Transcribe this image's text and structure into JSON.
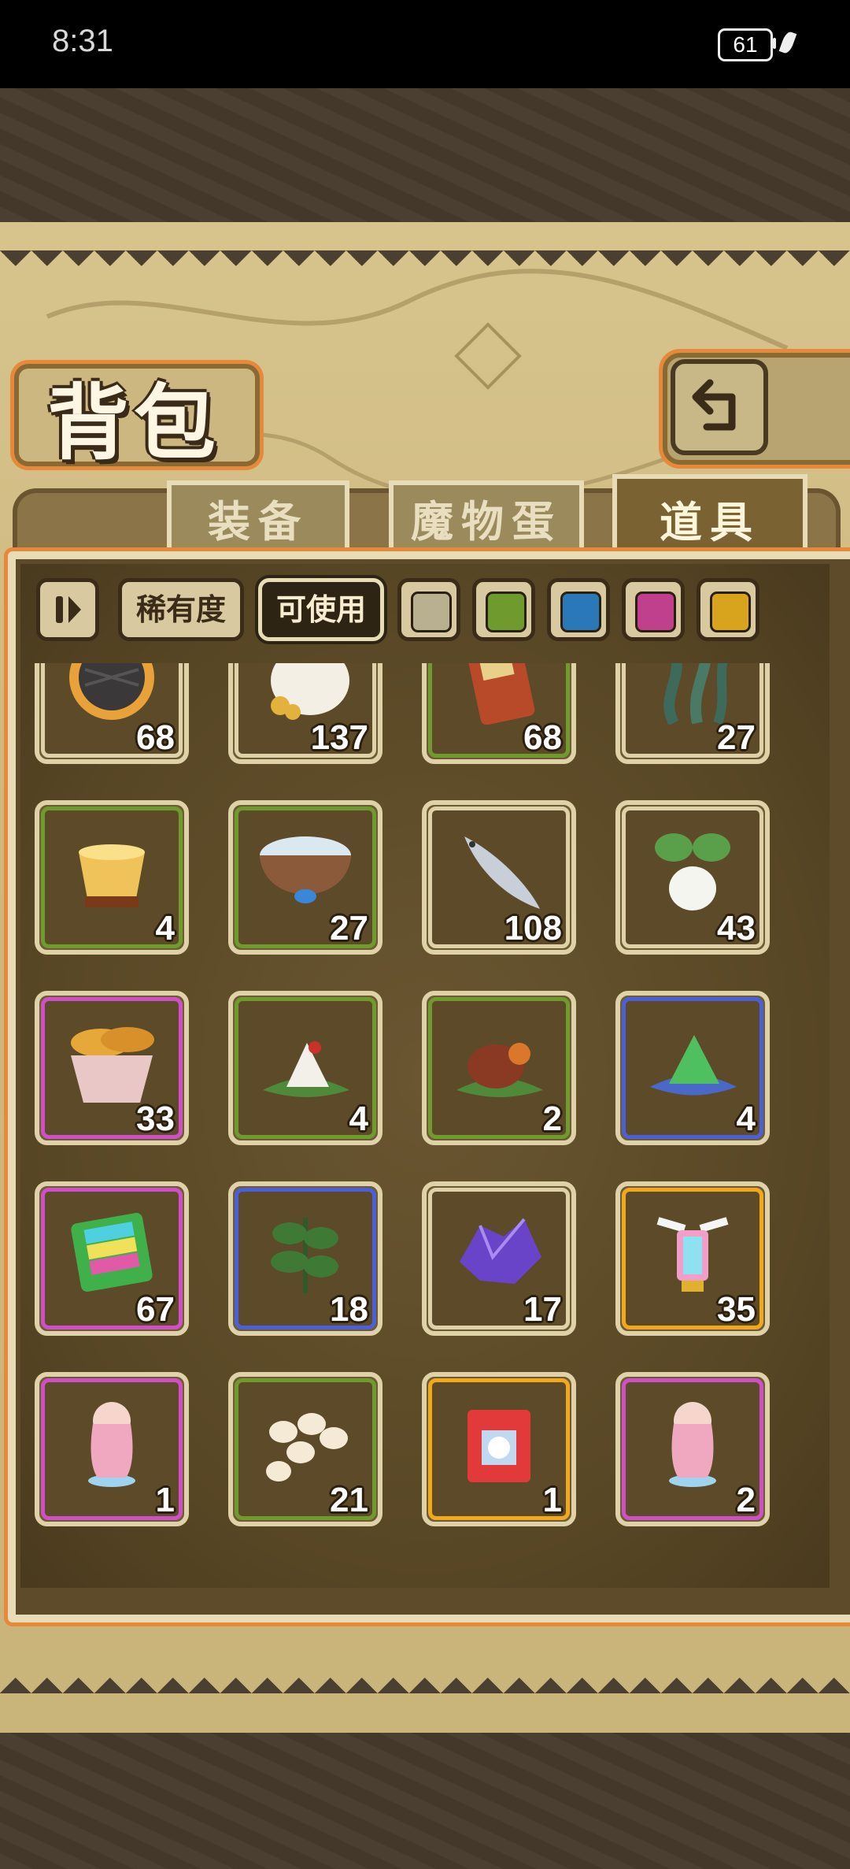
{
  "status": {
    "time": "8:31",
    "battery": "61"
  },
  "header": {
    "title": "背包",
    "back_icon": "return-arrow-icon"
  },
  "tabs": [
    {
      "label": "装备",
      "active": false
    },
    {
      "label": "魔物蛋",
      "active": false
    },
    {
      "label": "道具",
      "active": true
    }
  ],
  "filters": {
    "toggle_icon": "pause-toggle-icon",
    "rarity_label": "稀有度",
    "usable_label": "可使用",
    "usable_active": true,
    "rarity_colors": [
      "#b9b08f",
      "#6f9a2e",
      "#2b78b8",
      "#c0408e",
      "#d8a41e"
    ]
  },
  "rarity_palette": {
    "white": "#e0d2a8",
    "green": "#6f9a2e",
    "blue": "#4a5fd8",
    "purple": "#cf4fc7",
    "gold": "#f2a81c"
  },
  "items": [
    {
      "name": "charcoal-cookie",
      "icon": "cookie-icon",
      "count": "68",
      "rarity": "white"
    },
    {
      "name": "coin-sack",
      "icon": "money-bag-icon",
      "count": "137",
      "rarity": "white"
    },
    {
      "name": "snack-bag",
      "icon": "snack-bag-icon",
      "count": "68",
      "rarity": "green"
    },
    {
      "name": "seaweed",
      "icon": "seaweed-icon",
      "count": "27",
      "rarity": "white"
    },
    {
      "name": "pudding",
      "icon": "pudding-icon",
      "count": "4",
      "rarity": "green"
    },
    {
      "name": "water-bowl",
      "icon": "bowl-icon",
      "count": "27",
      "rarity": "green"
    },
    {
      "name": "small-fish",
      "icon": "fish-icon",
      "count": "108",
      "rarity": "white"
    },
    {
      "name": "radish",
      "icon": "radish-icon",
      "count": "43",
      "rarity": "white"
    },
    {
      "name": "bread-basket",
      "icon": "bread-basket-icon",
      "count": "33",
      "rarity": "purple"
    },
    {
      "name": "rice-dumpling",
      "icon": "dumpling-icon",
      "count": "4",
      "rarity": "green"
    },
    {
      "name": "meat-dumpling",
      "icon": "meat-icon",
      "count": "2",
      "rarity": "green"
    },
    {
      "name": "jade-dumpling",
      "icon": "gem-dumpling-icon",
      "count": "4",
      "rarity": "blue"
    },
    {
      "name": "rainbow-jelly",
      "icon": "jelly-icon",
      "count": "67",
      "rarity": "purple"
    },
    {
      "name": "herb-leaf",
      "icon": "leaf-icon",
      "count": "18",
      "rarity": "blue"
    },
    {
      "name": "crystal-ore",
      "icon": "crystal-icon",
      "count": "17",
      "rarity": "white"
    },
    {
      "name": "winged-lantern",
      "icon": "lantern-icon",
      "count": "35",
      "rarity": "gold"
    },
    {
      "name": "catgirl-figure",
      "icon": "figure-icon",
      "count": "1",
      "rarity": "purple"
    },
    {
      "name": "egg-pile",
      "icon": "eggs-icon",
      "count": "21",
      "rarity": "green"
    },
    {
      "name": "mystery-box",
      "icon": "gift-box-icon",
      "count": "1",
      "rarity": "gold"
    },
    {
      "name": "warrior-figure",
      "icon": "figure-icon",
      "count": "2",
      "rarity": "purple"
    }
  ]
}
